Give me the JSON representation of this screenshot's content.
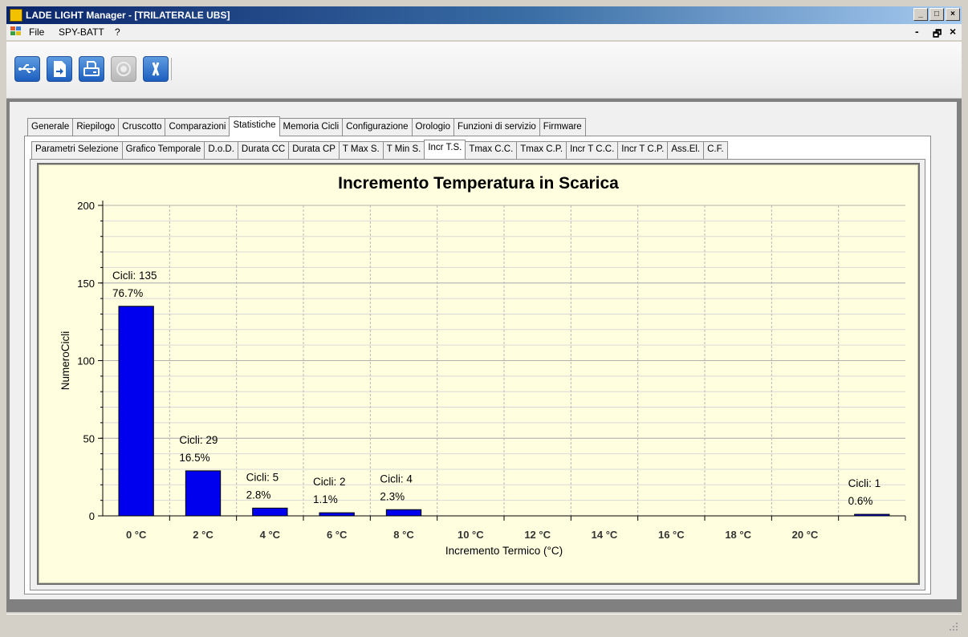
{
  "window": {
    "title": "LADE LIGHT Manager - [TRILATERALE UBS]",
    "buttons": [
      "_",
      "□",
      "×"
    ]
  },
  "menu": {
    "items": [
      "File",
      "SPY-BATT",
      "?"
    ],
    "mdi_controls": [
      "-",
      "ᗣ",
      "×"
    ]
  },
  "toolbar": {
    "buttons": [
      {
        "icon": "usb-icon",
        "enabled": true
      },
      {
        "icon": "document-export-icon",
        "enabled": true
      },
      {
        "icon": "print-icon",
        "enabled": true
      },
      {
        "icon": "record-icon",
        "enabled": false
      },
      {
        "icon": "close-icon",
        "enabled": true
      }
    ]
  },
  "tabs_main": [
    "Generale",
    "Riepilogo",
    "Cruscotto",
    "Comparazioni",
    "Statistiche",
    "Memoria Cicli",
    "Configurazione",
    "Orologio",
    "Funzioni di servizio",
    "Firmware"
  ],
  "tabs_main_active": "Statistiche",
  "tabs_stats": [
    "Parametri Selezione",
    "Grafico Temporale",
    "D.o.D.",
    "Durata CC",
    "Durata CP",
    "T Max S.",
    "T Min S.",
    "Incr T.S.",
    "Tmax C.C.",
    "Tmax C.P.",
    "Incr T C.C.",
    "Incr T C.P.",
    "Ass.El.",
    "C.F."
  ],
  "tabs_stats_active": "Incr T.S.",
  "chart_data": {
    "type": "bar",
    "title": "Incremento Temperatura in Scarica",
    "xlabel": "Incremento Termico (°C)",
    "ylabel": "NumeroCicli",
    "ylim": [
      0,
      200
    ],
    "yticks": [
      0,
      50,
      100,
      150,
      200
    ],
    "grid": true,
    "bar_color": "#0000ee",
    "categories": [
      "0 °C",
      "2 °C",
      "4 °C",
      "6 °C",
      "8 °C",
      "10 °C",
      "12 °C",
      "14 °C",
      "16 °C",
      "18 °C",
      "20 °C",
      ""
    ],
    "values": [
      135,
      29,
      5,
      2,
      4,
      0,
      0,
      0,
      0,
      0,
      0,
      1
    ],
    "labels": [
      [
        "Cicli: 135",
        "76.7%"
      ],
      [
        "Cicli: 29",
        "16.5%"
      ],
      [
        "Cicli: 5",
        "2.8%"
      ],
      [
        "Cicli: 2",
        "1.1%"
      ],
      [
        "Cicli: 4",
        "2.3%"
      ],
      null,
      null,
      null,
      null,
      null,
      null,
      [
        "Cicli: 1",
        "0.6%"
      ]
    ]
  }
}
